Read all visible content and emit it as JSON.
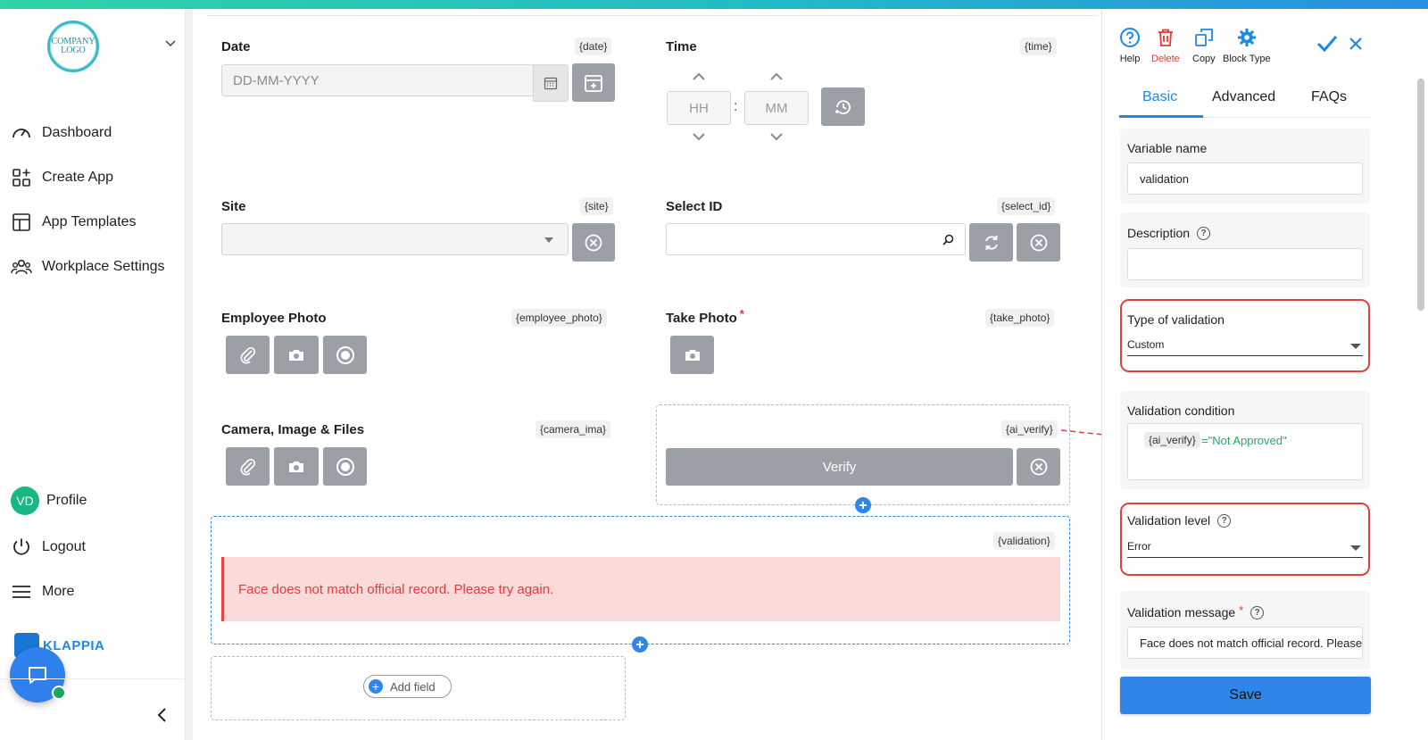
{
  "sidebar": {
    "logo_text": "COMPANY LOGO",
    "nav": [
      {
        "label": "Dashboard",
        "icon": "gauge-icon"
      },
      {
        "label": "Create App",
        "icon": "grid-plus-icon"
      },
      {
        "label": "App Templates",
        "icon": "layout-icon"
      },
      {
        "label": "Workplace Settings",
        "icon": "users-icon"
      }
    ],
    "profile": {
      "initials": "VD",
      "label": "Profile"
    },
    "logout_label": "Logout",
    "more_label": "More",
    "brand_text": "KLAPPIA"
  },
  "form": {
    "date": {
      "label": "Date",
      "tag": "{date}",
      "placeholder": "DD-MM-YYYY"
    },
    "time": {
      "label": "Time",
      "tag": "{time}",
      "hours_placeholder": "HH",
      "minutes_placeholder": "MM",
      "separator": ":"
    },
    "site": {
      "label": "Site",
      "tag": "{site}"
    },
    "select_id": {
      "label": "Select ID",
      "tag": "{select_id}"
    },
    "employee_photo": {
      "label": "Employee Photo",
      "tag": "{employee_photo}"
    },
    "take_photo": {
      "label": "Take Photo",
      "tag": "{take_photo}",
      "required_mark": "*"
    },
    "camera_files": {
      "label": "Camera, Image & Files",
      "tag": "{camera_ima}"
    },
    "ai_verify": {
      "tag": "{ai_verify}",
      "button_label": "Verify"
    },
    "validation": {
      "tag": "{validation}",
      "message": "Face does not match official record. Please try again."
    },
    "add_field_label": "Add field"
  },
  "panel": {
    "toolbar": {
      "help": "Help",
      "delete": "Delete",
      "copy": "Copy",
      "block_type": "Block Type"
    },
    "tabs": [
      "Basic",
      "Advanced",
      "FAQs"
    ],
    "active_tab": "Basic",
    "variable_name": {
      "label": "Variable name",
      "value": "validation"
    },
    "description": {
      "label": "Description",
      "value": ""
    },
    "type_of_validation": {
      "label": "Type of validation",
      "value": "Custom"
    },
    "validation_condition": {
      "label": "Validation condition",
      "tag": "{ai_verify}",
      "expression": "=\"Not Approved\""
    },
    "validation_level": {
      "label": "Validation level",
      "value": "Error"
    },
    "validation_message": {
      "label": "Validation message",
      "required_mark": "*",
      "value": "Face does not match official record. Please try again."
    },
    "save_label": "Save"
  },
  "colors": {
    "accent": "#2f86e8",
    "error": "#e24848",
    "gray_button": "#9aa0a6",
    "highlight": "#e24141"
  }
}
